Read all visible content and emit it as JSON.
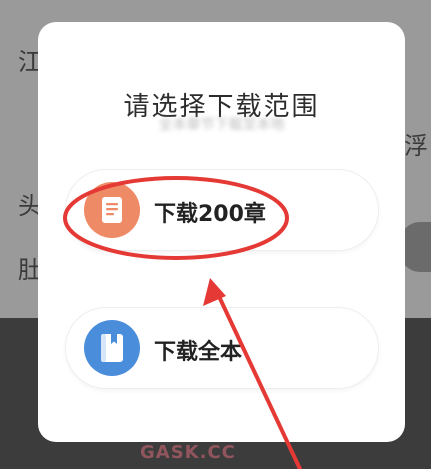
{
  "dialog": {
    "title": "请选择下载范围",
    "subtitle": "全本章节下载至本地",
    "options": [
      {
        "label": "下载200章",
        "icon": "document-icon",
        "color": "#ee8a65"
      },
      {
        "label": "下载全本",
        "icon": "book-icon",
        "color": "#4a8edb"
      }
    ]
  },
  "background": {
    "fragments": [
      "江",
      "浮",
      "头",
      "肚"
    ]
  },
  "watermark": "GASK.CC",
  "colors": {
    "annotation": "#e53935",
    "overlay": "#9a9a9a"
  }
}
